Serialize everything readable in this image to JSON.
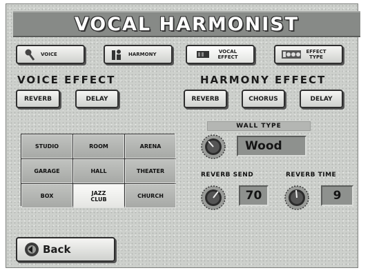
{
  "title": "VOCAL HARMONIST",
  "tabs": [
    {
      "label": "VOICE",
      "icon": "microphone-icon"
    },
    {
      "label": "HARMONY",
      "icon": "singers-icon"
    },
    {
      "label": "VOCAL EFFECT",
      "icon": "effect-icon",
      "active": true
    },
    {
      "label": "EFFECT TYPE",
      "icon": "effect-type-icon"
    }
  ],
  "voice_effect": {
    "title": "VOICE EFFECT",
    "buttons": [
      "REVERB",
      "DELAY"
    ]
  },
  "harmony_effect": {
    "title": "HARMONY EFFECT",
    "buttons": [
      "REVERB",
      "CHORUS",
      "DELAY"
    ]
  },
  "room_types": [
    [
      "STUDIO",
      "ROOM",
      "ARENA"
    ],
    [
      "GARAGE",
      "HALL",
      "THEATER"
    ],
    [
      "BOX",
      "JAZZ CLUB",
      "CHURCH"
    ]
  ],
  "selected_room": "JAZZ CLUB",
  "wall_type": {
    "label": "WALL TYPE",
    "value": "Wood"
  },
  "reverb_send": {
    "label": "REVERB SEND",
    "value": "70"
  },
  "reverb_time": {
    "label": "REVERB TIME",
    "value": "9"
  },
  "back_button": {
    "label": "Back"
  },
  "colors": {
    "screen": "#cdd0cc",
    "title_bar": "#878a87",
    "value_box": "#8e918e"
  }
}
